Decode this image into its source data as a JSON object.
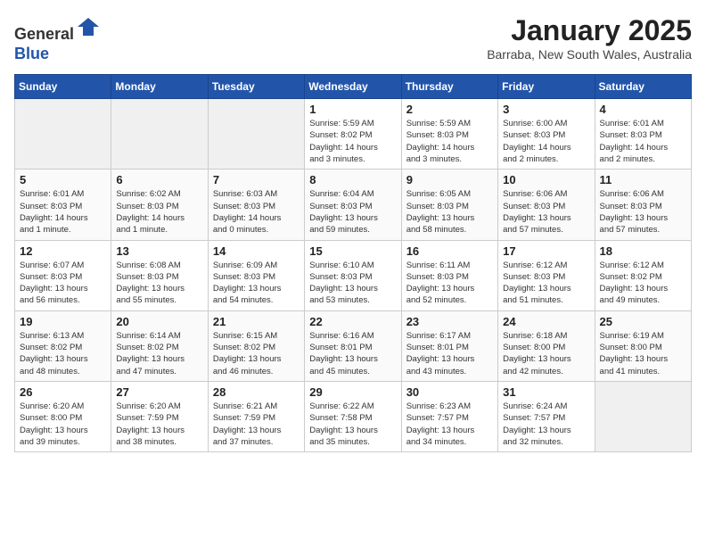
{
  "header": {
    "logo_line1": "General",
    "logo_line2": "Blue",
    "title": "January 2025",
    "subtitle": "Barraba, New South Wales, Australia"
  },
  "days_of_week": [
    "Sunday",
    "Monday",
    "Tuesday",
    "Wednesday",
    "Thursday",
    "Friday",
    "Saturday"
  ],
  "weeks": [
    [
      {
        "day": "",
        "info": ""
      },
      {
        "day": "",
        "info": ""
      },
      {
        "day": "",
        "info": ""
      },
      {
        "day": "1",
        "info": "Sunrise: 5:59 AM\nSunset: 8:02 PM\nDaylight: 14 hours\nand 3 minutes."
      },
      {
        "day": "2",
        "info": "Sunrise: 5:59 AM\nSunset: 8:03 PM\nDaylight: 14 hours\nand 3 minutes."
      },
      {
        "day": "3",
        "info": "Sunrise: 6:00 AM\nSunset: 8:03 PM\nDaylight: 14 hours\nand 2 minutes."
      },
      {
        "day": "4",
        "info": "Sunrise: 6:01 AM\nSunset: 8:03 PM\nDaylight: 14 hours\nand 2 minutes."
      }
    ],
    [
      {
        "day": "5",
        "info": "Sunrise: 6:01 AM\nSunset: 8:03 PM\nDaylight: 14 hours\nand 1 minute."
      },
      {
        "day": "6",
        "info": "Sunrise: 6:02 AM\nSunset: 8:03 PM\nDaylight: 14 hours\nand 1 minute."
      },
      {
        "day": "7",
        "info": "Sunrise: 6:03 AM\nSunset: 8:03 PM\nDaylight: 14 hours\nand 0 minutes."
      },
      {
        "day": "8",
        "info": "Sunrise: 6:04 AM\nSunset: 8:03 PM\nDaylight: 13 hours\nand 59 minutes."
      },
      {
        "day": "9",
        "info": "Sunrise: 6:05 AM\nSunset: 8:03 PM\nDaylight: 13 hours\nand 58 minutes."
      },
      {
        "day": "10",
        "info": "Sunrise: 6:06 AM\nSunset: 8:03 PM\nDaylight: 13 hours\nand 57 minutes."
      },
      {
        "day": "11",
        "info": "Sunrise: 6:06 AM\nSunset: 8:03 PM\nDaylight: 13 hours\nand 57 minutes."
      }
    ],
    [
      {
        "day": "12",
        "info": "Sunrise: 6:07 AM\nSunset: 8:03 PM\nDaylight: 13 hours\nand 56 minutes."
      },
      {
        "day": "13",
        "info": "Sunrise: 6:08 AM\nSunset: 8:03 PM\nDaylight: 13 hours\nand 55 minutes."
      },
      {
        "day": "14",
        "info": "Sunrise: 6:09 AM\nSunset: 8:03 PM\nDaylight: 13 hours\nand 54 minutes."
      },
      {
        "day": "15",
        "info": "Sunrise: 6:10 AM\nSunset: 8:03 PM\nDaylight: 13 hours\nand 53 minutes."
      },
      {
        "day": "16",
        "info": "Sunrise: 6:11 AM\nSunset: 8:03 PM\nDaylight: 13 hours\nand 52 minutes."
      },
      {
        "day": "17",
        "info": "Sunrise: 6:12 AM\nSunset: 8:03 PM\nDaylight: 13 hours\nand 51 minutes."
      },
      {
        "day": "18",
        "info": "Sunrise: 6:12 AM\nSunset: 8:02 PM\nDaylight: 13 hours\nand 49 minutes."
      }
    ],
    [
      {
        "day": "19",
        "info": "Sunrise: 6:13 AM\nSunset: 8:02 PM\nDaylight: 13 hours\nand 48 minutes."
      },
      {
        "day": "20",
        "info": "Sunrise: 6:14 AM\nSunset: 8:02 PM\nDaylight: 13 hours\nand 47 minutes."
      },
      {
        "day": "21",
        "info": "Sunrise: 6:15 AM\nSunset: 8:02 PM\nDaylight: 13 hours\nand 46 minutes."
      },
      {
        "day": "22",
        "info": "Sunrise: 6:16 AM\nSunset: 8:01 PM\nDaylight: 13 hours\nand 45 minutes."
      },
      {
        "day": "23",
        "info": "Sunrise: 6:17 AM\nSunset: 8:01 PM\nDaylight: 13 hours\nand 43 minutes."
      },
      {
        "day": "24",
        "info": "Sunrise: 6:18 AM\nSunset: 8:00 PM\nDaylight: 13 hours\nand 42 minutes."
      },
      {
        "day": "25",
        "info": "Sunrise: 6:19 AM\nSunset: 8:00 PM\nDaylight: 13 hours\nand 41 minutes."
      }
    ],
    [
      {
        "day": "26",
        "info": "Sunrise: 6:20 AM\nSunset: 8:00 PM\nDaylight: 13 hours\nand 39 minutes."
      },
      {
        "day": "27",
        "info": "Sunrise: 6:20 AM\nSunset: 7:59 PM\nDaylight: 13 hours\nand 38 minutes."
      },
      {
        "day": "28",
        "info": "Sunrise: 6:21 AM\nSunset: 7:59 PM\nDaylight: 13 hours\nand 37 minutes."
      },
      {
        "day": "29",
        "info": "Sunrise: 6:22 AM\nSunset: 7:58 PM\nDaylight: 13 hours\nand 35 minutes."
      },
      {
        "day": "30",
        "info": "Sunrise: 6:23 AM\nSunset: 7:57 PM\nDaylight: 13 hours\nand 34 minutes."
      },
      {
        "day": "31",
        "info": "Sunrise: 6:24 AM\nSunset: 7:57 PM\nDaylight: 13 hours\nand 32 minutes."
      },
      {
        "day": "",
        "info": ""
      }
    ]
  ]
}
